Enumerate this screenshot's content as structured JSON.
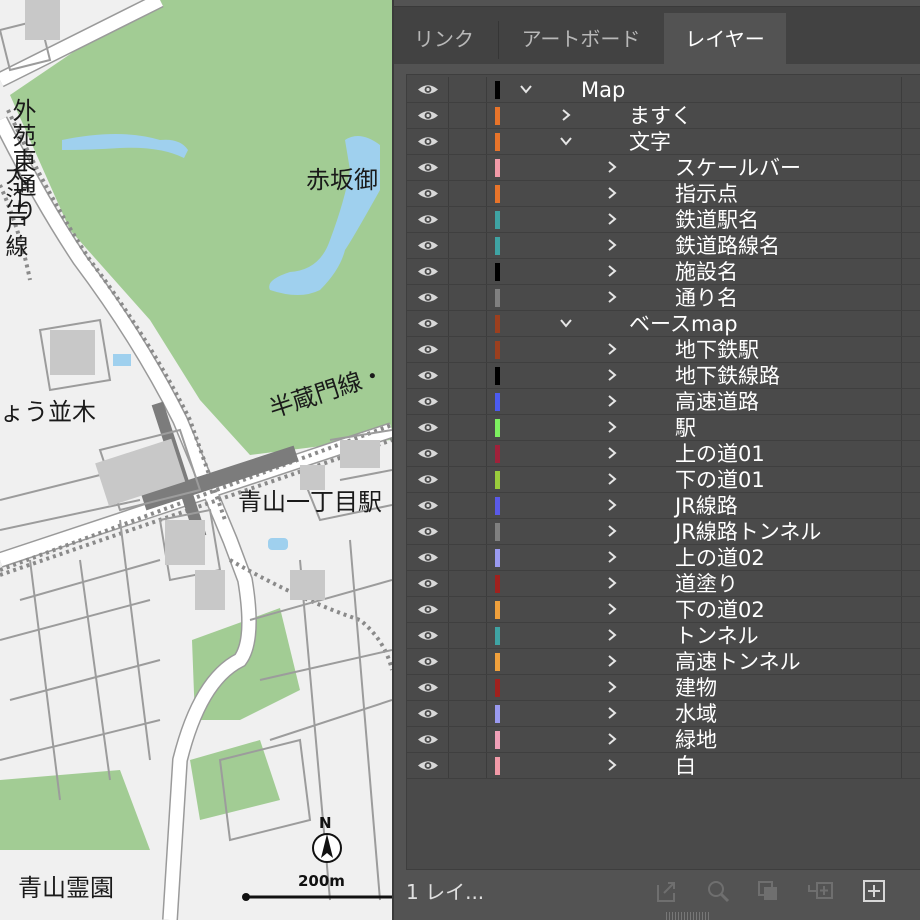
{
  "map": {
    "labels": {
      "sotobori": "外苑東通り",
      "oedo": "大江戸線",
      "akasaka": "赤坂御",
      "icho": "ょう並木",
      "hanzomon": "半蔵門線・",
      "aoyama_station": "青山一丁目駅",
      "cemetery": "青山霊園"
    },
    "north_label": "N",
    "scale_label": "200m"
  },
  "panel": {
    "tabs": [
      {
        "label": "リンク",
        "active": false
      },
      {
        "label": "アートボード",
        "active": false
      },
      {
        "label": "レイヤー",
        "active": true
      }
    ],
    "layers": [
      {
        "name": "Map",
        "depth": 0,
        "expanded": true,
        "color": "#000000"
      },
      {
        "name": "ますく",
        "depth": 1,
        "expanded": false,
        "color": "#e8742a"
      },
      {
        "name": "文字",
        "depth": 1,
        "expanded": true,
        "color": "#e8742a"
      },
      {
        "name": "スケールバー",
        "depth": 2,
        "expanded": false,
        "color": "#f29aa8"
      },
      {
        "name": "指示点",
        "depth": 2,
        "expanded": false,
        "color": "#e8742a"
      },
      {
        "name": "鉄道駅名",
        "depth": 2,
        "expanded": false,
        "color": "#3fa3a3"
      },
      {
        "name": "鉄道路線名",
        "depth": 2,
        "expanded": false,
        "color": "#3fa3a3"
      },
      {
        "name": "施設名",
        "depth": 2,
        "expanded": false,
        "color": "#000000"
      },
      {
        "name": "通り名",
        "depth": 2,
        "expanded": false,
        "color": "#808080"
      },
      {
        "name": "ベースmap",
        "depth": 1,
        "expanded": true,
        "color": "#9c3f1e"
      },
      {
        "name": "地下鉄駅",
        "depth": 2,
        "expanded": false,
        "color": "#9c3f1e"
      },
      {
        "name": "地下鉄線路",
        "depth": 2,
        "expanded": false,
        "color": "#000000"
      },
      {
        "name": "高速道路",
        "depth": 2,
        "expanded": false,
        "color": "#4b5bf0"
      },
      {
        "name": "駅",
        "depth": 2,
        "expanded": false,
        "color": "#7df060"
      },
      {
        "name": "上の道01",
        "depth": 2,
        "expanded": false,
        "color": "#a0213a"
      },
      {
        "name": "下の道01",
        "depth": 2,
        "expanded": false,
        "color": "#9acd3c"
      },
      {
        "name": "JR線路",
        "depth": 2,
        "expanded": false,
        "color": "#5a5ae8"
      },
      {
        "name": "JR線路トンネル",
        "depth": 2,
        "expanded": false,
        "color": "#808080"
      },
      {
        "name": "上の道02",
        "depth": 2,
        "expanded": false,
        "color": "#9a9af0"
      },
      {
        "name": "道塗り",
        "depth": 2,
        "expanded": false,
        "color": "#a0211e"
      },
      {
        "name": "下の道02",
        "depth": 2,
        "expanded": false,
        "color": "#f0a03c"
      },
      {
        "name": "トンネル",
        "depth": 2,
        "expanded": false,
        "color": "#3fa3a3"
      },
      {
        "name": "高速トンネル",
        "depth": 2,
        "expanded": false,
        "color": "#f0a03c"
      },
      {
        "name": "建物",
        "depth": 2,
        "expanded": false,
        "color": "#a0211e"
      },
      {
        "name": "水域",
        "depth": 2,
        "expanded": false,
        "color": "#9a9af0"
      },
      {
        "name": "緑地",
        "depth": 2,
        "expanded": false,
        "color": "#f0a0b8"
      },
      {
        "name": "白",
        "depth": 2,
        "expanded": false,
        "color": "#f29aa8"
      }
    ],
    "footer": {
      "layer_count": "1 レイ..."
    },
    "tools": [
      {
        "icon": "export-icon"
      },
      {
        "icon": "search-layer-icon"
      },
      {
        "icon": "clipping-mask-icon"
      },
      {
        "icon": "new-sublayer-icon"
      },
      {
        "icon": "new-layer-icon"
      }
    ]
  }
}
